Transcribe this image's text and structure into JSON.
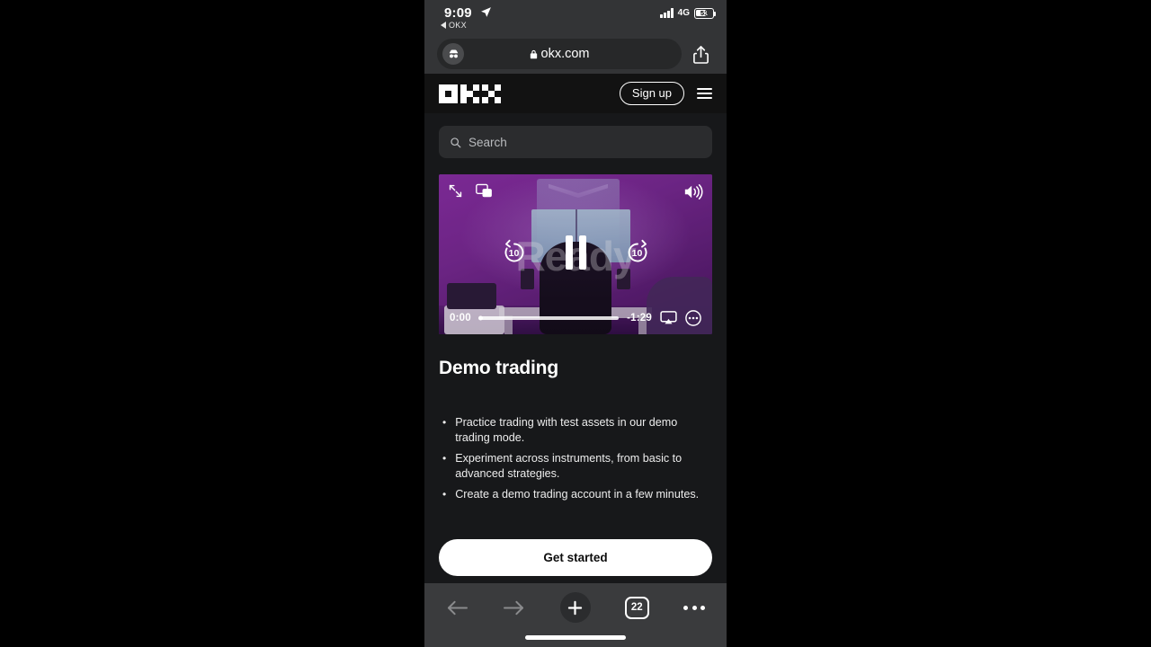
{
  "status_bar": {
    "time": "9:09",
    "location_icon": "location-arrow-icon",
    "back_app_label": "OKX",
    "network": "4G",
    "battery_percent": "51",
    "signal_icon": "signal-bars-icon"
  },
  "browser": {
    "url": "okx.com",
    "lock_icon": "lock-icon",
    "incognito_icon": "incognito-icon",
    "share_icon": "share-icon",
    "bottom_bar": {
      "back_icon": "back-arrow-icon",
      "forward_icon": "forward-arrow-icon",
      "new_tab_icon": "plus-icon",
      "tab_count": "22",
      "more_icon": "more-dots-icon"
    }
  },
  "site_header": {
    "logo_name": "okx-logo",
    "signup_label": "Sign up",
    "menu_icon": "hamburger-menu-icon"
  },
  "search": {
    "placeholder": "Search",
    "icon": "search-icon"
  },
  "video": {
    "fullscreen_icon": "fullscreen-expand-icon",
    "pip_icon": "picture-in-picture-icon",
    "volume_icon": "volume-on-icon",
    "rewind_label": "10",
    "forward_label": "10",
    "pause_icon": "pause-icon",
    "current_time": "0:00",
    "remaining_time": "-1:29",
    "airplay_icon": "airplay-icon",
    "more_icon": "video-more-options-icon",
    "poster_text": "Ready",
    "progress_percent": 0
  },
  "content": {
    "title": "Demo trading",
    "bullets": [
      "Practice trading with test assets in our demo trading mode.",
      "Experiment across instruments, from basic to advanced strategies.",
      "Create a demo trading account in a few minutes."
    ],
    "cta_label": "Get started"
  },
  "colors": {
    "page_bg": "#17181a",
    "header_bg": "#121212",
    "chrome_bg": "#333436",
    "toolbar_bg": "#3a3b3d",
    "accent_white": "#ffffff",
    "video_purple": "#7b2a96"
  }
}
